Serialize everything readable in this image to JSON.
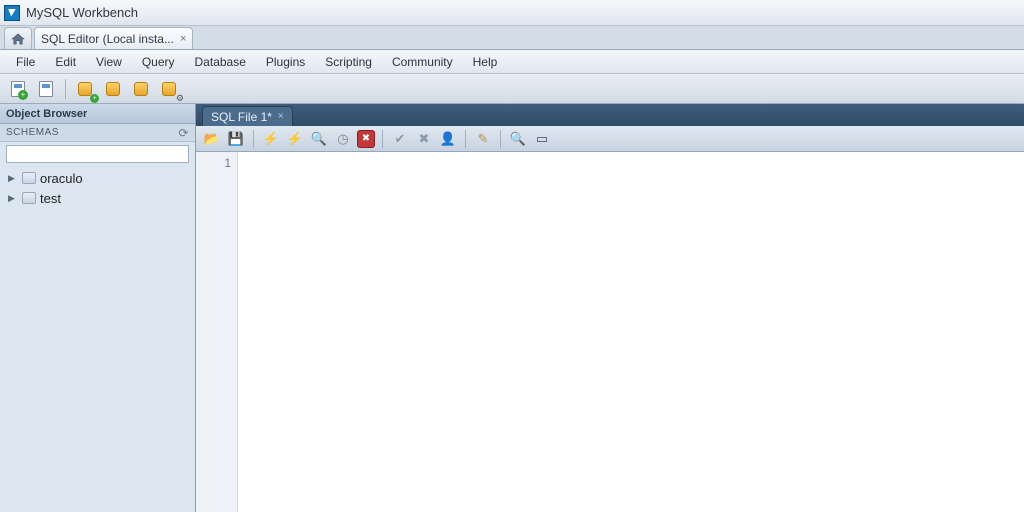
{
  "app_title": "MySQL Workbench",
  "main_tab": "SQL Editor (Local insta...",
  "menu": [
    "File",
    "Edit",
    "View",
    "Query",
    "Database",
    "Plugins",
    "Scripting",
    "Community",
    "Help"
  ],
  "sidebar": {
    "title": "Object Browser",
    "section": "SCHEMAS",
    "schemas": [
      "oraculo",
      "test"
    ]
  },
  "editor": {
    "file_tab": "SQL File 1*",
    "gutter_line": "1"
  }
}
